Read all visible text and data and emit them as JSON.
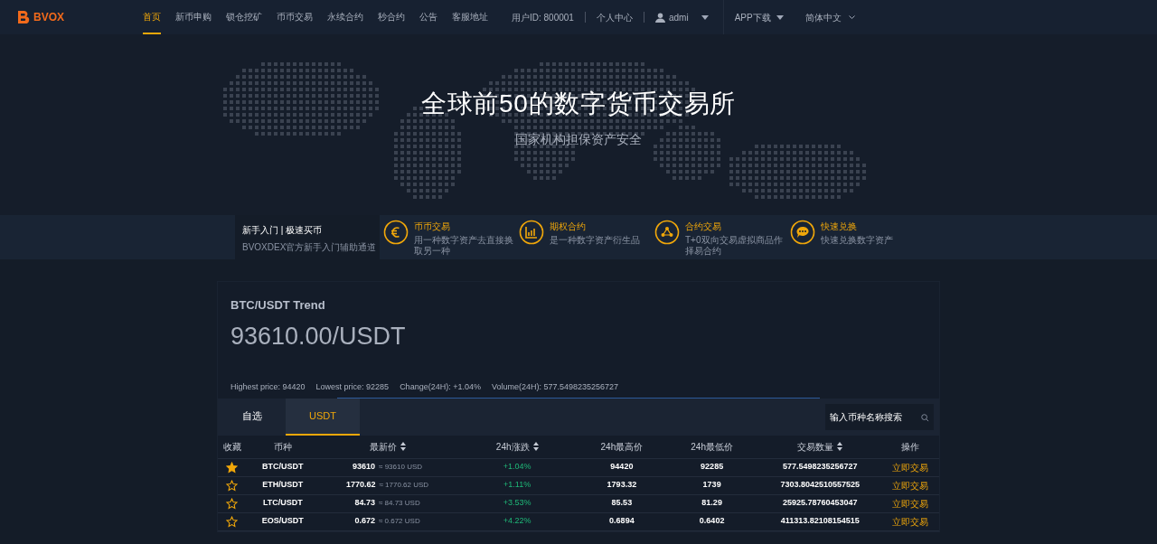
{
  "header": {
    "logo": "BVOX",
    "nav": [
      {
        "label": "首页",
        "selected": true
      },
      {
        "label": "新币申购",
        "selected": false
      },
      {
        "label": "锁仓挖矿",
        "selected": false
      },
      {
        "label": "币币交易",
        "selected": false
      },
      {
        "label": "永续合约",
        "selected": false
      },
      {
        "label": "秒合约",
        "selected": false
      },
      {
        "label": "公告",
        "selected": false
      },
      {
        "label": "客服地址",
        "selected": false
      }
    ],
    "user_id": "用户ID: 800001",
    "personal_center": "个人中心",
    "user": "admi",
    "app_download": "APP下载",
    "language": "简体中文"
  },
  "hero": {
    "title": "全球前50的数字货币交易所",
    "subtitle": "国家机构担保资产安全"
  },
  "features": {
    "intro_title": "新手入门 | 极速买币",
    "intro_subtitle": "BVOXDEX官方新手入门辅助通道",
    "items": [
      {
        "kind": "euro",
        "title": "币币交易",
        "desc": "用一种数字资产去直接换取另一种"
      },
      {
        "kind": "chart",
        "title": "期权合约",
        "desc": "是一种数字资产衍生品"
      },
      {
        "kind": "network",
        "title": "合约交易",
        "desc": "T+0双向交易虚拟商品作择易合约"
      },
      {
        "kind": "chat",
        "title": "快速兑换",
        "desc": "快速兑换数字资产"
      }
    ]
  },
  "trend": {
    "title": "BTC/USDT Trend",
    "price": "93610.00/USDT",
    "stats": [
      "Highest price: 94420",
      "Lowest price: 92285",
      "Change(24H): +1.04%",
      "Volume(24H): 577.5498235256727"
    ]
  },
  "market": {
    "tabs": [
      {
        "label": "自选",
        "selected": false
      },
      {
        "label": "USDT",
        "selected": true
      }
    ],
    "search": {
      "placeholder": "输入币种名称搜索"
    },
    "columns": [
      {
        "label": "收藏",
        "sortable": false
      },
      {
        "label": "币种",
        "sortable": false
      },
      {
        "label": "最新价",
        "sortable": true
      },
      {
        "label": "24h涨跌",
        "sortable": true
      },
      {
        "label": "24h最高价",
        "sortable": false
      },
      {
        "label": "24h最低价",
        "sortable": false
      },
      {
        "label": "交易数量",
        "sortable": true
      },
      {
        "label": "操作",
        "sortable": false
      }
    ],
    "rows": [
      {
        "favorite": true,
        "pair": "BTC/USDT",
        "price": "93610",
        "price_usd": "≈ 93610 USD",
        "change": "+1.04%",
        "high": "94420",
        "low": "92285",
        "volume": "577.5498235256727",
        "action": "立即交易"
      },
      {
        "favorite": false,
        "pair": "ETH/USDT",
        "price": "1770.62",
        "price_usd": "≈ 1770.62 USD",
        "change": "+1.11%",
        "high": "1793.32",
        "low": "1739",
        "volume": "7303.8042510557525",
        "action": "立即交易"
      },
      {
        "favorite": false,
        "pair": "LTC/USDT",
        "price": "84.73",
        "price_usd": "≈ 84.73 USD",
        "change": "+3.53%",
        "high": "85.53",
        "low": "81.29",
        "volume": "25925.78760453047",
        "action": "立即交易"
      },
      {
        "favorite": false,
        "pair": "EOS/USDT",
        "price": "0.672",
        "price_usd": "≈ 0.672 USD",
        "change": "+4.22%",
        "high": "0.6894",
        "low": "0.6402",
        "volume": "411313.82108154515",
        "action": "立即交易"
      }
    ]
  }
}
